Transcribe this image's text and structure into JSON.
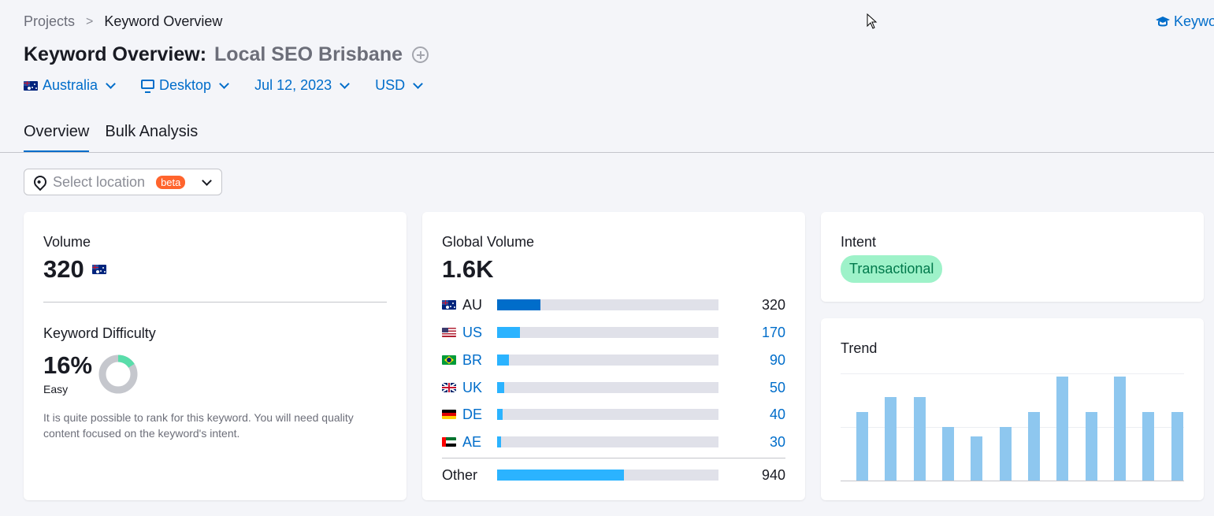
{
  "breadcrumb": {
    "projects": "Projects",
    "sep": ">",
    "current": "Keyword Overview"
  },
  "top_link": {
    "label": "Keyword"
  },
  "header": {
    "title_prefix": "Keyword Overview:",
    "keyword": "Local SEO Brisbane"
  },
  "filters": {
    "country": "Australia",
    "device": "Desktop",
    "date": "Jul 12, 2023",
    "currency": "USD"
  },
  "tabs": [
    {
      "label": "Overview",
      "active": true
    },
    {
      "label": "Bulk Analysis",
      "active": false
    }
  ],
  "location": {
    "placeholder": "Select location",
    "badge": "beta"
  },
  "volume_card": {
    "label": "Volume",
    "value": "320",
    "kd_label": "Keyword Difficulty",
    "kd_value": "16%",
    "kd_percent": 16,
    "kd_level": "Easy",
    "kd_text": "It is quite possible to rank for this keyword. You will need quality content focused on the keyword's intent."
  },
  "global_card": {
    "label": "Global Volume",
    "value": "1.6K",
    "rows": [
      {
        "code": "AU",
        "value": "320",
        "fraction": 0.196,
        "flag": "au",
        "color": "#006dca",
        "link": false
      },
      {
        "code": "US",
        "value": "170",
        "fraction": 0.104,
        "flag": "us",
        "color": "#2bb3ff",
        "link": true
      },
      {
        "code": "BR",
        "value": "90",
        "fraction": 0.055,
        "flag": "br",
        "color": "#2bb3ff",
        "link": true
      },
      {
        "code": "UK",
        "value": "50",
        "fraction": 0.031,
        "flag": "uk",
        "color": "#2bb3ff",
        "link": true
      },
      {
        "code": "DE",
        "value": "40",
        "fraction": 0.025,
        "flag": "de",
        "color": "#2bb3ff",
        "link": true
      },
      {
        "code": "AE",
        "value": "30",
        "fraction": 0.018,
        "flag": "ae",
        "color": "#2bb3ff",
        "link": true
      }
    ],
    "other": {
      "label": "Other",
      "value": "940",
      "fraction": 0.573
    }
  },
  "intent_card": {
    "label": "Intent",
    "value": "Transactional"
  },
  "trend_card": {
    "label": "Trend",
    "chart_data": {
      "type": "bar",
      "values": [
        0.64,
        0.78,
        0.78,
        0.5,
        0.41,
        0.5,
        0.64,
        0.97,
        0.64,
        0.97,
        0.64,
        0.64
      ],
      "ylim": [
        0,
        1
      ]
    }
  },
  "colors": {
    "accent": "#006dca",
    "bar_light": "#2bb3ff",
    "track": "#e0e1e9",
    "intent_bg": "#9ef2c9",
    "intent_text": "#00794b",
    "kd_easy": "#59ddaa",
    "trend": "#8ec7ef"
  }
}
